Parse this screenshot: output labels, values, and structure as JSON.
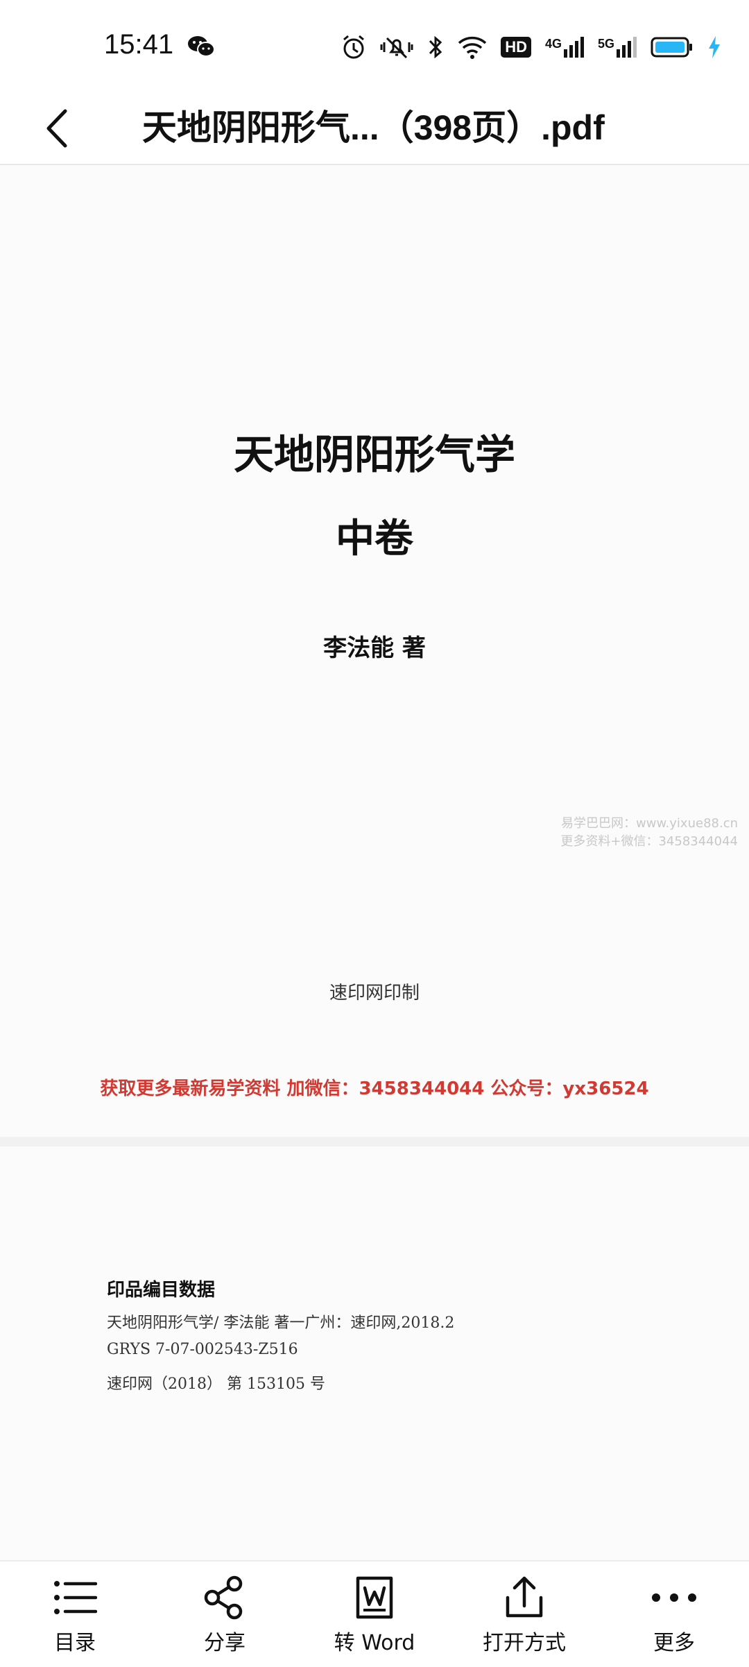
{
  "status_bar": {
    "time": "15:41",
    "hd_label": "HD",
    "net1_label": "4G",
    "net2_label": "5G",
    "icons": [
      "wechat-icon",
      "alarm-icon",
      "vibrate-icon",
      "bluetooth-icon",
      "wifi-icon",
      "battery-icon",
      "charging-icon"
    ]
  },
  "header": {
    "title": "天地阴阳形气...（398页）.pdf"
  },
  "page1": {
    "title": "天地阴阳形气学",
    "volume": "中卷",
    "author": "李法能  著",
    "watermark_line1": "易学巴巴网：www.yixue88.cn",
    "watermark_line2": "更多资料+微信：3458344044",
    "printer": "速印网印制",
    "promo": "获取更多最新易学资料 加微信：3458344044 公众号：yx36524"
  },
  "page2": {
    "heading": "印品编目数据",
    "lines": [
      "天地阴阳形气学/ 李法能 著一广州：速印网,2018.2",
      "GRYS   7-07-002543-Z516",
      "速印网（2018） 第 153105 号"
    ]
  },
  "toolbar": {
    "items": [
      {
        "label": "目录",
        "icon": "list-icon"
      },
      {
        "label": "分享",
        "icon": "share-icon"
      },
      {
        "label": "转 Word",
        "icon": "word-convert-icon"
      },
      {
        "label": "打开方式",
        "icon": "open-with-icon"
      },
      {
        "label": "更多",
        "icon": "more-icon"
      }
    ]
  },
  "colors": {
    "promo_red": "#d03a32",
    "battery_blue": "#29b6f6",
    "charge_blue": "#29b6f6"
  }
}
